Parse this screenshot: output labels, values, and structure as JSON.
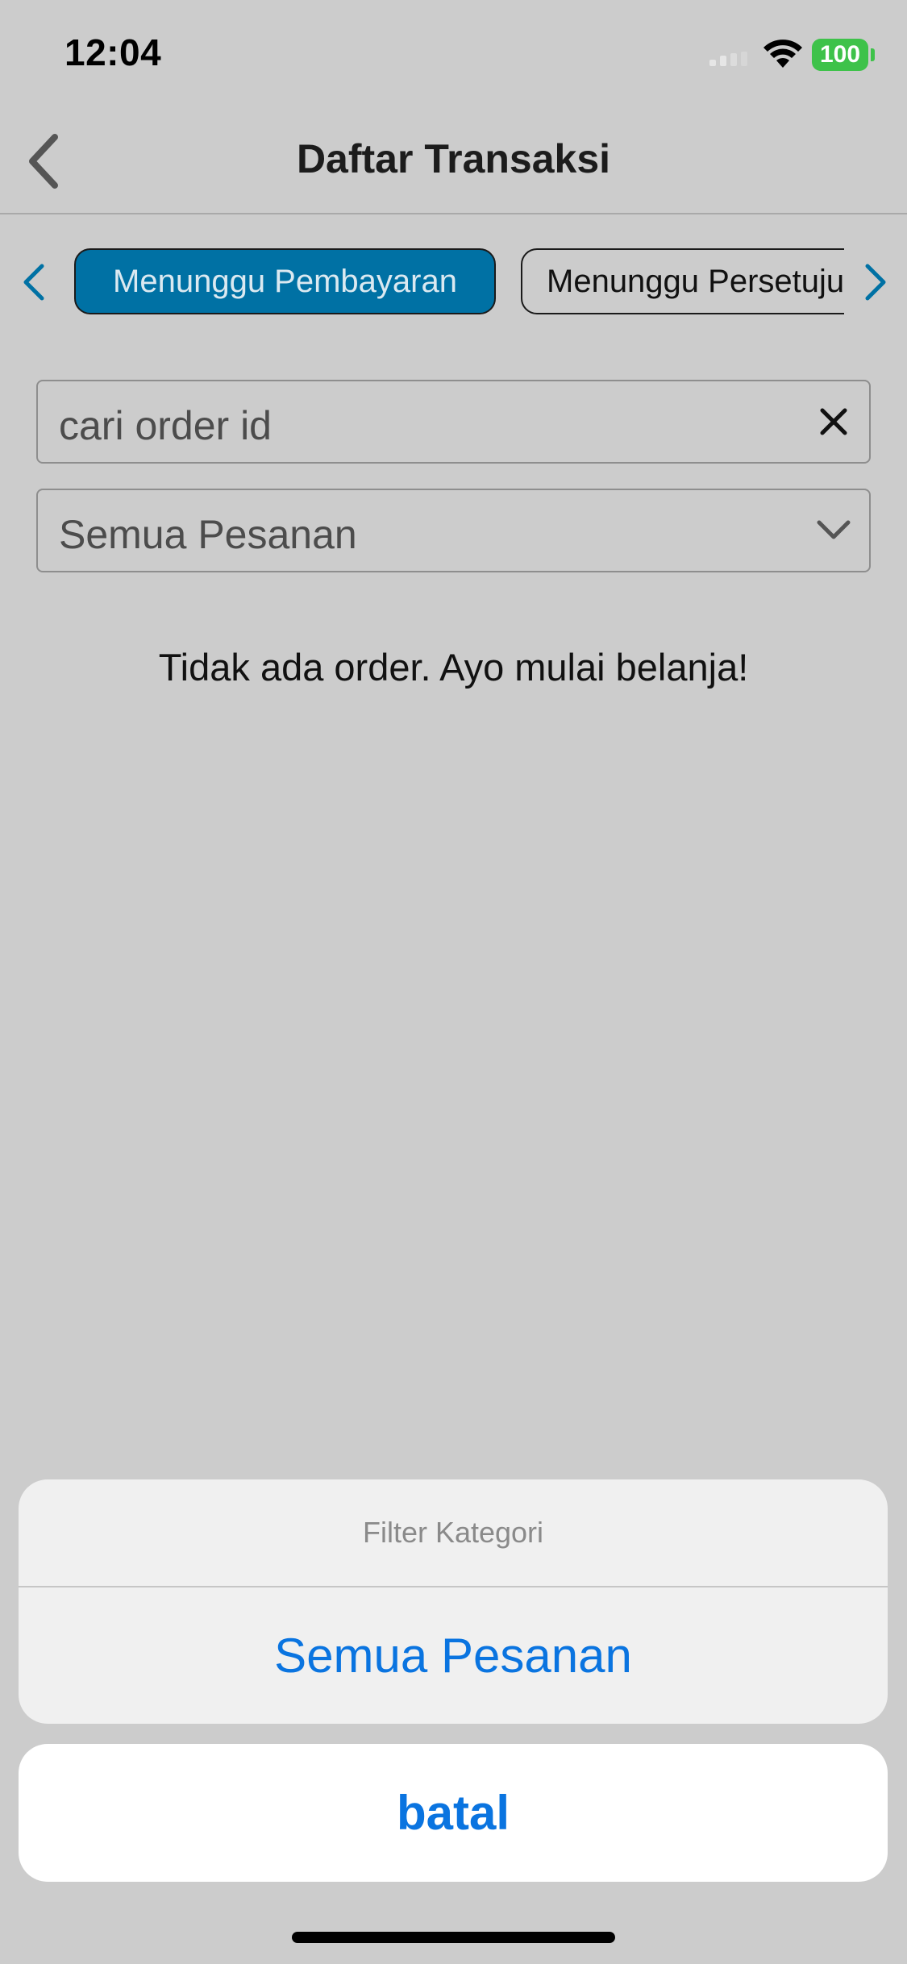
{
  "status_bar": {
    "time": "12:04",
    "battery": "100",
    "battery_color": "#3ec24a",
    "signal_icon": "cellular-signal-icon",
    "wifi_icon": "wifi-icon"
  },
  "nav": {
    "title": "Daftar Transaksi",
    "back_icon": "chevron-left-icon"
  },
  "tabs": {
    "items": [
      {
        "label": "Menunggu Pembayaran",
        "active": true
      },
      {
        "label": "Menunggu Persetujuan",
        "active": false
      }
    ],
    "active_color": "#0071a4",
    "arrow_color": "#0071a4"
  },
  "search": {
    "placeholder": "cari order id",
    "clear_icon": "close-icon"
  },
  "filter": {
    "selected": "Semua Pesanan",
    "icon": "chevron-down-icon"
  },
  "empty_state": {
    "message": "Tidak ada order. Ayo mulai belanja!"
  },
  "action_sheet": {
    "title": "Filter Kategori",
    "options": [
      "Semua Pesanan"
    ],
    "cancel": "batal",
    "accent_color": "#0a74e0"
  }
}
